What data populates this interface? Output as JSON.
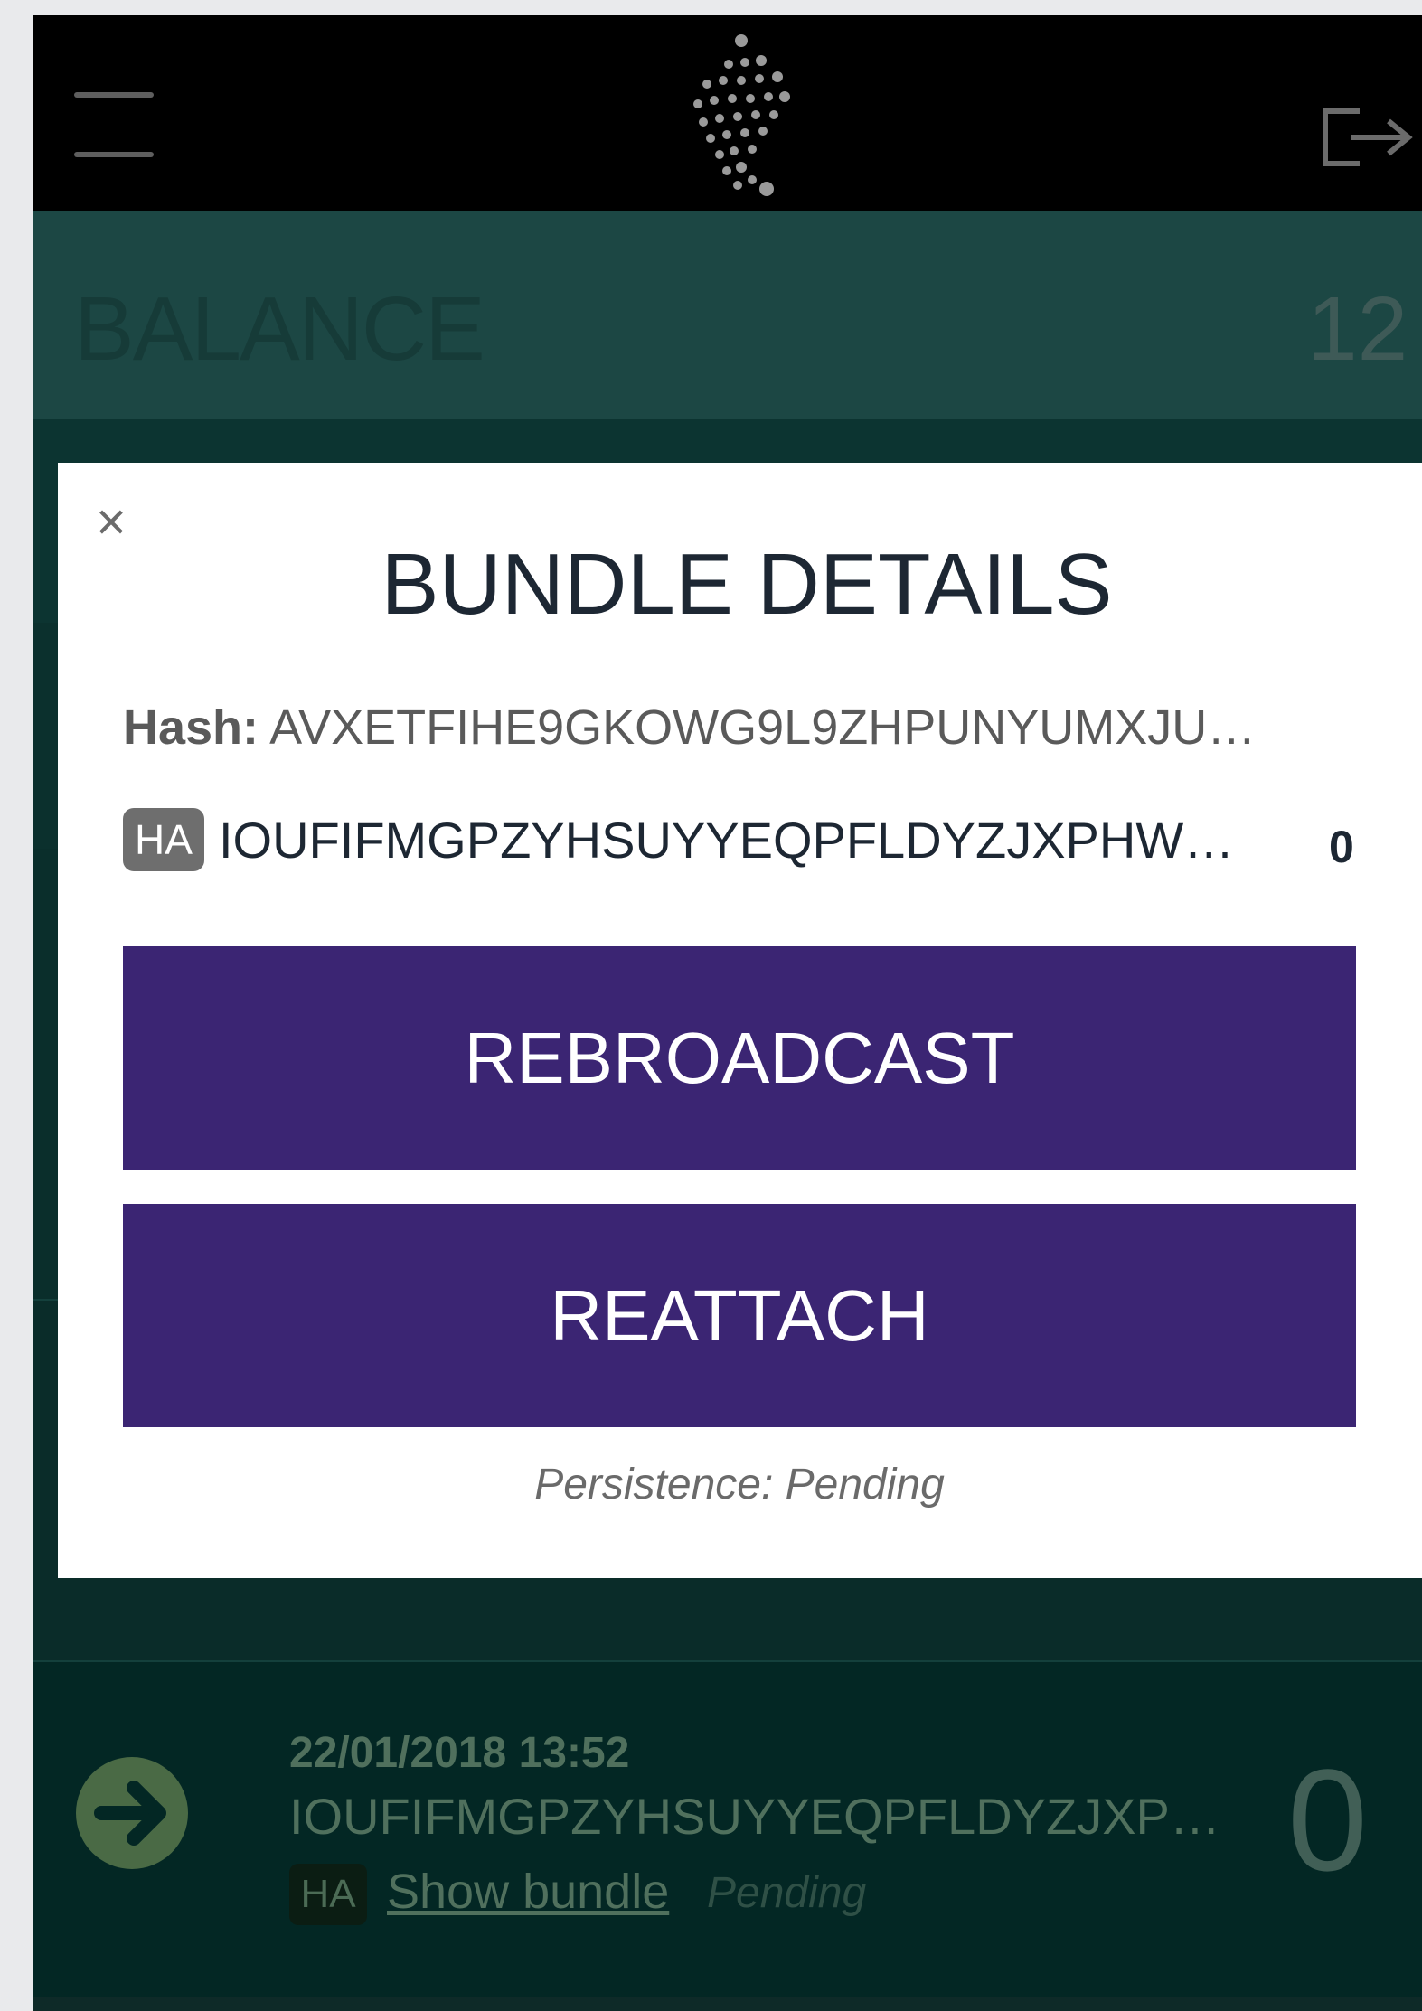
{
  "header": {
    "menu_icon": "hamburger-menu-icon",
    "logo_icon": "iota-logo",
    "logout_icon": "logout-icon"
  },
  "balance": {
    "label": "BALANCE",
    "value": "12"
  },
  "modal": {
    "title": "BUNDLE DETAILS",
    "close_symbol": "×",
    "hash_label": "Hash:",
    "hash_value": "AVXETFIHE9GKOWG9L9ZHPUNYUMXJU…",
    "address_badge": "HA",
    "address": "IOUFIFMGPZYHSUYYEQPFLDYZJXPHW…",
    "address_value": "0",
    "rebroadcast_label": "REBROADCAST",
    "reattach_label": "REATTACH",
    "persistence_text": "Persistence: Pending"
  },
  "transaction": {
    "date": "22/01/2018 13:52",
    "address": "IOUFIFMGPZYHSUYYEQPFLDYZJXP…",
    "badge": "HA",
    "show_bundle_label": "Show bundle",
    "status": "Pending",
    "value": "0",
    "direction_icon": "arrow-right-circle-icon"
  },
  "colors": {
    "header_bg": "#000000",
    "balance_bg": "#1c4744",
    "button_bg": "#3b2573",
    "modal_bg": "#ffffff"
  }
}
